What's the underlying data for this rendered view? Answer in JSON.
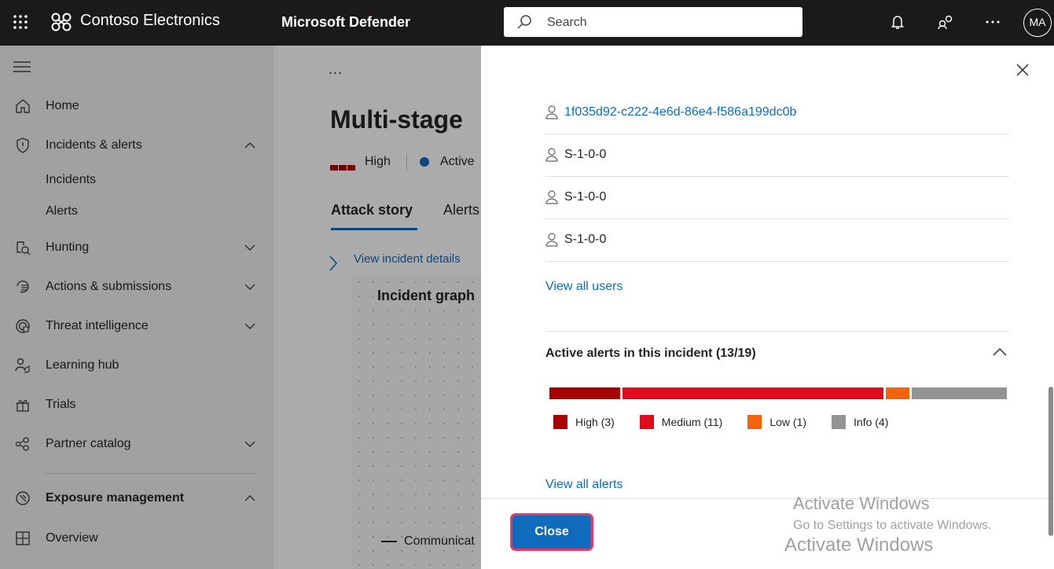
{
  "topbar": {
    "org_name": "Contoso Electronics",
    "app_name": "Microsoft Defender",
    "search_placeholder": "Search",
    "avatar_initials": "MA",
    "icons": [
      "waffle-icon",
      "org-logo-icon",
      "search-icon",
      "bell-icon",
      "community-icon",
      "more-icon"
    ]
  },
  "nav": {
    "items": [
      {
        "label": "Home",
        "icon": "home-icon"
      },
      {
        "label": "Incidents & alerts",
        "icon": "shield-icon",
        "expanded": true
      },
      {
        "label": "Incidents"
      },
      {
        "label": "Alerts"
      },
      {
        "label": "Hunting",
        "icon": "hunting-icon"
      },
      {
        "label": "Actions & submissions",
        "icon": "actions-icon"
      },
      {
        "label": "Threat intelligence",
        "icon": "threat-intel-icon"
      },
      {
        "label": "Learning hub",
        "icon": "learning-icon"
      },
      {
        "label": "Trials",
        "icon": "trials-icon"
      },
      {
        "label": "Partner catalog",
        "icon": "partner-icon"
      },
      {
        "label": "Exposure management",
        "icon": "exposure-icon",
        "expanded": true
      },
      {
        "label": "Overview",
        "icon": "overview-icon"
      }
    ]
  },
  "main": {
    "more": "...",
    "title": "Multi-stage",
    "severity": "High",
    "status": "Active",
    "tabs": [
      "Attack story",
      "Alerts"
    ],
    "incident_details_link": "View incident details",
    "graph_title": "Incident graph",
    "graph_legend": "Communicat"
  },
  "panel": {
    "users": [
      {
        "name": "1f035d92-c222-4e6d-86e4-f586a199dc0b",
        "link": true
      },
      {
        "name": "S-1-0-0",
        "link": false
      },
      {
        "name": "S-1-0-0",
        "link": false
      },
      {
        "name": "S-1-0-0",
        "link": false
      }
    ],
    "view_all_users": "View all users",
    "alerts_title": "Active alerts in this incident (13/19)",
    "alert_breakdown": [
      {
        "label": "High (3)",
        "count": 3,
        "color": "#a80000"
      },
      {
        "label": "Medium (11)",
        "count": 11,
        "color": "#e00b1c"
      },
      {
        "label": "Low (1)",
        "count": 1,
        "color": "#f7630c"
      },
      {
        "label": "Info (4)",
        "count": 4,
        "color": "#949494"
      }
    ],
    "view_all_alerts": "View all alerts",
    "close_label": "Close"
  },
  "watermark": {
    "line1": "Activate Windows",
    "line2": "Go to Settings to activate Windows.",
    "line3": "Activate Windows"
  }
}
